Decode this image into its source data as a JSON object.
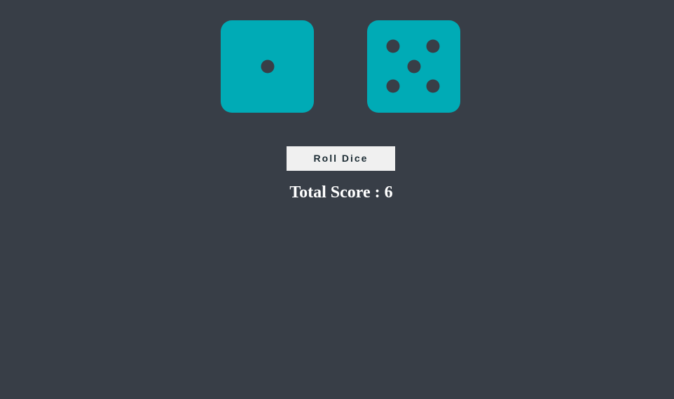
{
  "dice": [
    {
      "name": "die-left",
      "value": 1
    },
    {
      "name": "die-right",
      "value": 5
    }
  ],
  "controls": {
    "roll_label": "Roll Dice"
  },
  "score": {
    "label": "Total Score",
    "separator": " : ",
    "value": "6"
  },
  "colors": {
    "background": "#383e47",
    "die_face": "#00abb6",
    "pip": "#383e47",
    "button_bg": "#f0f0f0",
    "score_text": "#ffffff"
  }
}
